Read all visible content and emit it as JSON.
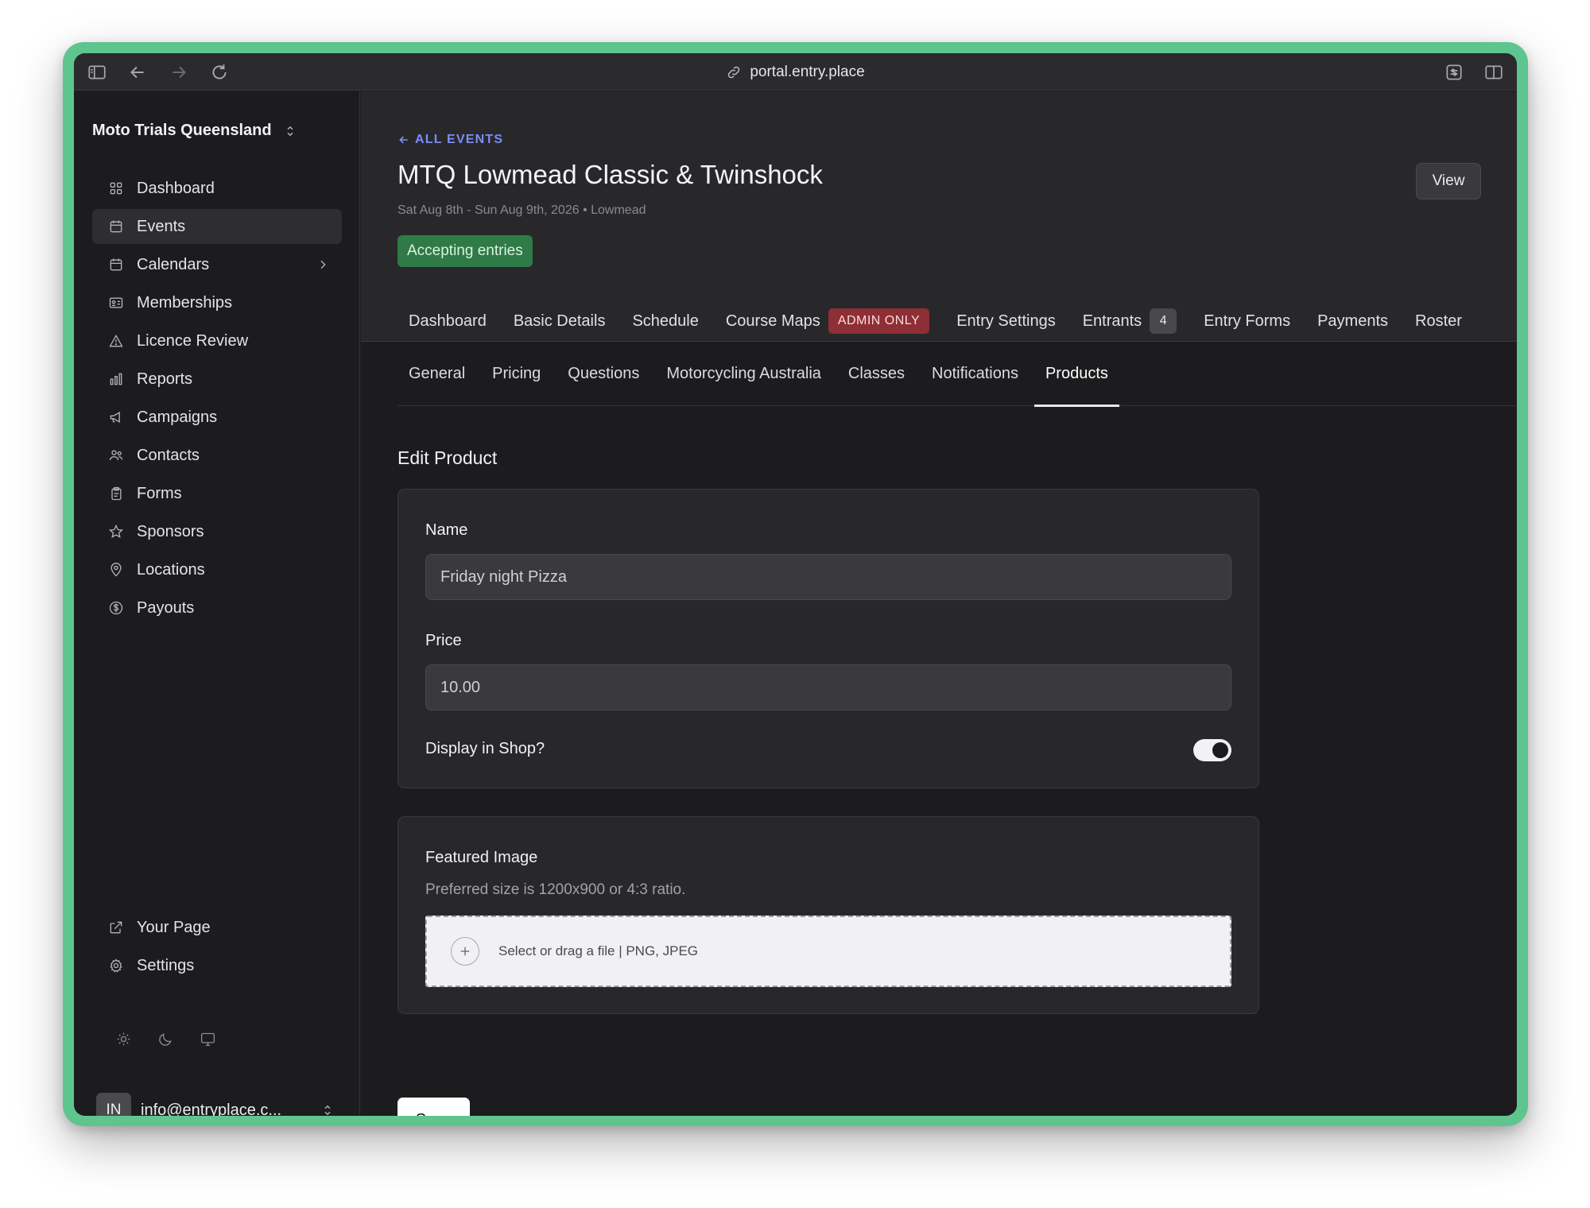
{
  "browser": {
    "url": "portal.entry.place"
  },
  "sidebar": {
    "org_name": "Moto Trials Queensland",
    "items": [
      {
        "label": "Dashboard",
        "icon": "grid-icon"
      },
      {
        "label": "Events",
        "icon": "calendar-icon",
        "active": true
      },
      {
        "label": "Calendars",
        "icon": "calendar-icon",
        "has_submenu": true
      },
      {
        "label": "Memberships",
        "icon": "id-card-icon"
      },
      {
        "label": "Licence Review",
        "icon": "warning-icon"
      },
      {
        "label": "Reports",
        "icon": "bar-chart-icon"
      },
      {
        "label": "Campaigns",
        "icon": "megaphone-icon"
      },
      {
        "label": "Contacts",
        "icon": "users-icon"
      },
      {
        "label": "Forms",
        "icon": "clipboard-icon"
      },
      {
        "label": "Sponsors",
        "icon": "star-icon"
      },
      {
        "label": "Locations",
        "icon": "map-pin-icon"
      },
      {
        "label": "Payouts",
        "icon": "dollar-icon"
      }
    ],
    "bottom_items": [
      {
        "label": "Your Page",
        "icon": "external-link-icon"
      },
      {
        "label": "Settings",
        "icon": "gear-icon"
      }
    ],
    "user": {
      "initials": "IN",
      "email": "info@entryplace.c..."
    }
  },
  "event": {
    "back_label": "ALL EVENTS",
    "title": "MTQ Lowmead Classic & Twinshock",
    "meta": "Sat Aug 8th - Sun Aug 9th, 2026 • Lowmead",
    "status": "Accepting entries",
    "view_label": "View"
  },
  "tabs": [
    {
      "label": "Dashboard"
    },
    {
      "label": "Basic Details"
    },
    {
      "label": "Schedule"
    },
    {
      "label": "Course Maps",
      "badge": "ADMIN ONLY"
    },
    {
      "label": "Entry Settings"
    },
    {
      "label": "Entrants",
      "count": "4"
    },
    {
      "label": "Entry Forms"
    },
    {
      "label": "Payments"
    },
    {
      "label": "Roster"
    }
  ],
  "subtabs": [
    {
      "label": "General"
    },
    {
      "label": "Pricing"
    },
    {
      "label": "Questions"
    },
    {
      "label": "Motorcycling Australia"
    },
    {
      "label": "Classes"
    },
    {
      "label": "Notifications"
    },
    {
      "label": "Products",
      "active": true
    }
  ],
  "form": {
    "section_title": "Edit Product",
    "name_label": "Name",
    "name_value": "Friday night Pizza",
    "price_label": "Price",
    "price_value": "10.00",
    "display_label": "Display in Shop?",
    "display_on": true,
    "image_label": "Featured Image",
    "image_help": "Preferred size is 1200x900 or 4:3 ratio.",
    "dropzone_text": "Select or drag a file | PNG, JPEG",
    "save_label": "Save"
  },
  "colors": {
    "frame": "#5ec58f",
    "accent_link": "#7b8cf5",
    "status_green": "#2f7a46",
    "admin_badge": "#8d2f35"
  }
}
